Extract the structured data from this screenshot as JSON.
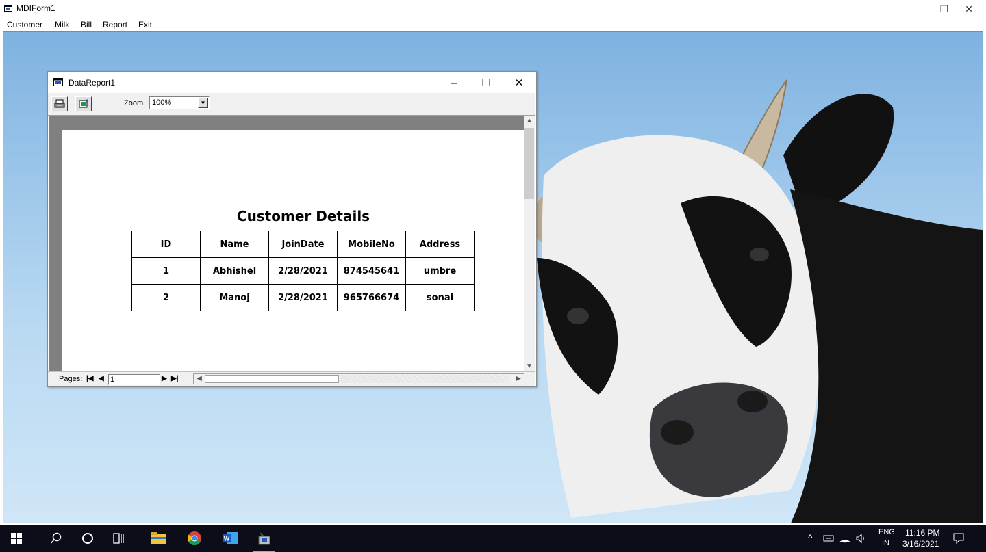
{
  "app": {
    "title": "MDIForm1"
  },
  "window_controls": {
    "minimize": "–",
    "restore": "❐",
    "close": "✕"
  },
  "menu": [
    {
      "label": "Customer"
    },
    {
      "label": "Milk"
    },
    {
      "label": "Bill"
    },
    {
      "label": "Report"
    },
    {
      "label": "Exit"
    }
  ],
  "report_window": {
    "title": "DataReport1",
    "controls": {
      "minimize": "–",
      "maximize": "☐",
      "close": "✕"
    },
    "toolbar": {
      "zoom_label": "Zoom",
      "zoom_value": "100%"
    },
    "report": {
      "title": "Customer Details",
      "columns": [
        "ID",
        "Name",
        "JoinDate",
        "MobileNo",
        "Address"
      ],
      "rows": [
        [
          "1",
          "Abhishel",
          "2/28/2021",
          "874545641",
          "umbre"
        ],
        [
          "2",
          "Manoj",
          "2/28/2021",
          "965766674",
          "sonai"
        ]
      ]
    },
    "statusbar": {
      "pages_label": "Pages:",
      "page_value": "1"
    }
  },
  "taskbar": {
    "icons": [
      "windows-start-icon",
      "search-icon",
      "cortana-icon",
      "task-view-icon",
      "file-explorer-icon",
      "chrome-icon",
      "word-icon",
      "vb-app-icon"
    ],
    "active_app": "vb-app-icon",
    "tray": {
      "language_top": "ENG",
      "language_bottom": "IN",
      "time": "11:16 PM",
      "date": "3/16/2021"
    }
  }
}
